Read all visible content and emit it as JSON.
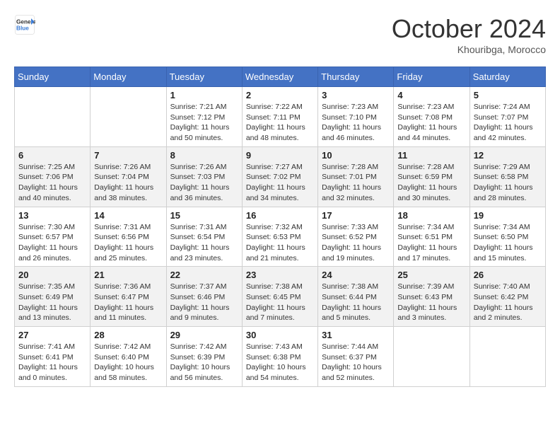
{
  "header": {
    "logo_general": "General",
    "logo_blue": "Blue",
    "month_title": "October 2024",
    "location": "Khouribga, Morocco"
  },
  "days_of_week": [
    "Sunday",
    "Monday",
    "Tuesday",
    "Wednesday",
    "Thursday",
    "Friday",
    "Saturday"
  ],
  "weeks": [
    [
      {
        "day": "",
        "info": ""
      },
      {
        "day": "",
        "info": ""
      },
      {
        "day": "1",
        "info": "Sunrise: 7:21 AM\nSunset: 7:12 PM\nDaylight: 11 hours and 50 minutes."
      },
      {
        "day": "2",
        "info": "Sunrise: 7:22 AM\nSunset: 7:11 PM\nDaylight: 11 hours and 48 minutes."
      },
      {
        "day": "3",
        "info": "Sunrise: 7:23 AM\nSunset: 7:10 PM\nDaylight: 11 hours and 46 minutes."
      },
      {
        "day": "4",
        "info": "Sunrise: 7:23 AM\nSunset: 7:08 PM\nDaylight: 11 hours and 44 minutes."
      },
      {
        "day": "5",
        "info": "Sunrise: 7:24 AM\nSunset: 7:07 PM\nDaylight: 11 hours and 42 minutes."
      }
    ],
    [
      {
        "day": "6",
        "info": "Sunrise: 7:25 AM\nSunset: 7:06 PM\nDaylight: 11 hours and 40 minutes."
      },
      {
        "day": "7",
        "info": "Sunrise: 7:26 AM\nSunset: 7:04 PM\nDaylight: 11 hours and 38 minutes."
      },
      {
        "day": "8",
        "info": "Sunrise: 7:26 AM\nSunset: 7:03 PM\nDaylight: 11 hours and 36 minutes."
      },
      {
        "day": "9",
        "info": "Sunrise: 7:27 AM\nSunset: 7:02 PM\nDaylight: 11 hours and 34 minutes."
      },
      {
        "day": "10",
        "info": "Sunrise: 7:28 AM\nSunset: 7:01 PM\nDaylight: 11 hours and 32 minutes."
      },
      {
        "day": "11",
        "info": "Sunrise: 7:28 AM\nSunset: 6:59 PM\nDaylight: 11 hours and 30 minutes."
      },
      {
        "day": "12",
        "info": "Sunrise: 7:29 AM\nSunset: 6:58 PM\nDaylight: 11 hours and 28 minutes."
      }
    ],
    [
      {
        "day": "13",
        "info": "Sunrise: 7:30 AM\nSunset: 6:57 PM\nDaylight: 11 hours and 26 minutes."
      },
      {
        "day": "14",
        "info": "Sunrise: 7:31 AM\nSunset: 6:56 PM\nDaylight: 11 hours and 25 minutes."
      },
      {
        "day": "15",
        "info": "Sunrise: 7:31 AM\nSunset: 6:54 PM\nDaylight: 11 hours and 23 minutes."
      },
      {
        "day": "16",
        "info": "Sunrise: 7:32 AM\nSunset: 6:53 PM\nDaylight: 11 hours and 21 minutes."
      },
      {
        "day": "17",
        "info": "Sunrise: 7:33 AM\nSunset: 6:52 PM\nDaylight: 11 hours and 19 minutes."
      },
      {
        "day": "18",
        "info": "Sunrise: 7:34 AM\nSunset: 6:51 PM\nDaylight: 11 hours and 17 minutes."
      },
      {
        "day": "19",
        "info": "Sunrise: 7:34 AM\nSunset: 6:50 PM\nDaylight: 11 hours and 15 minutes."
      }
    ],
    [
      {
        "day": "20",
        "info": "Sunrise: 7:35 AM\nSunset: 6:49 PM\nDaylight: 11 hours and 13 minutes."
      },
      {
        "day": "21",
        "info": "Sunrise: 7:36 AM\nSunset: 6:47 PM\nDaylight: 11 hours and 11 minutes."
      },
      {
        "day": "22",
        "info": "Sunrise: 7:37 AM\nSunset: 6:46 PM\nDaylight: 11 hours and 9 minutes."
      },
      {
        "day": "23",
        "info": "Sunrise: 7:38 AM\nSunset: 6:45 PM\nDaylight: 11 hours and 7 minutes."
      },
      {
        "day": "24",
        "info": "Sunrise: 7:38 AM\nSunset: 6:44 PM\nDaylight: 11 hours and 5 minutes."
      },
      {
        "day": "25",
        "info": "Sunrise: 7:39 AM\nSunset: 6:43 PM\nDaylight: 11 hours and 3 minutes."
      },
      {
        "day": "26",
        "info": "Sunrise: 7:40 AM\nSunset: 6:42 PM\nDaylight: 11 hours and 2 minutes."
      }
    ],
    [
      {
        "day": "27",
        "info": "Sunrise: 7:41 AM\nSunset: 6:41 PM\nDaylight: 11 hours and 0 minutes."
      },
      {
        "day": "28",
        "info": "Sunrise: 7:42 AM\nSunset: 6:40 PM\nDaylight: 10 hours and 58 minutes."
      },
      {
        "day": "29",
        "info": "Sunrise: 7:42 AM\nSunset: 6:39 PM\nDaylight: 10 hours and 56 minutes."
      },
      {
        "day": "30",
        "info": "Sunrise: 7:43 AM\nSunset: 6:38 PM\nDaylight: 10 hours and 54 minutes."
      },
      {
        "day": "31",
        "info": "Sunrise: 7:44 AM\nSunset: 6:37 PM\nDaylight: 10 hours and 52 minutes."
      },
      {
        "day": "",
        "info": ""
      },
      {
        "day": "",
        "info": ""
      }
    ]
  ]
}
